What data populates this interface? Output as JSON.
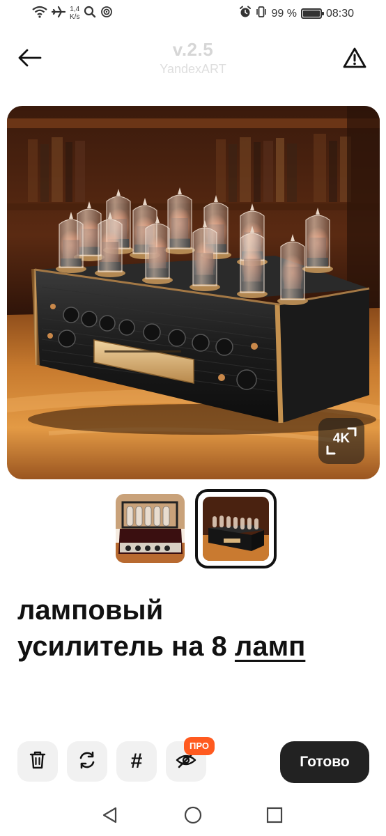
{
  "status_bar": {
    "net_speed_value": "1,4",
    "net_speed_unit": "K/s",
    "battery_percent": 99,
    "battery_label": "99 %",
    "time": "08:30",
    "icons": [
      "wifi-icon",
      "airplane-icon",
      "search-icon",
      "hotspot-icon",
      "alarm-icon",
      "vibrate-icon",
      "battery-icon"
    ]
  },
  "header": {
    "version": "v.2.5",
    "model": "YandexART",
    "icons": [
      "back-arrow-icon",
      "warning-icon"
    ]
  },
  "main_image": {
    "badge": "4K",
    "description_icons": [
      "expand-icon"
    ]
  },
  "thumbnails": {
    "count": 2,
    "selected_index": 1
  },
  "prompt": {
    "line1": "ламповый",
    "line2_plain": "усилитель на 8 ",
    "line2_underlined": "ламп"
  },
  "actions": {
    "icons": [
      "trash-icon",
      "regenerate-icon",
      "hashtag-icon",
      "hide-icon"
    ],
    "hash_symbol": "#",
    "pro_label": "ПРО",
    "done_label": "Готово"
  },
  "navbar": {
    "icons": [
      "nav-back-icon",
      "nav-home-icon",
      "nav-recent-icon"
    ]
  },
  "colors": {
    "accent_pro": "#ff5a1f",
    "done_button": "#222222",
    "action_button_bg": "#f1f1f1"
  }
}
